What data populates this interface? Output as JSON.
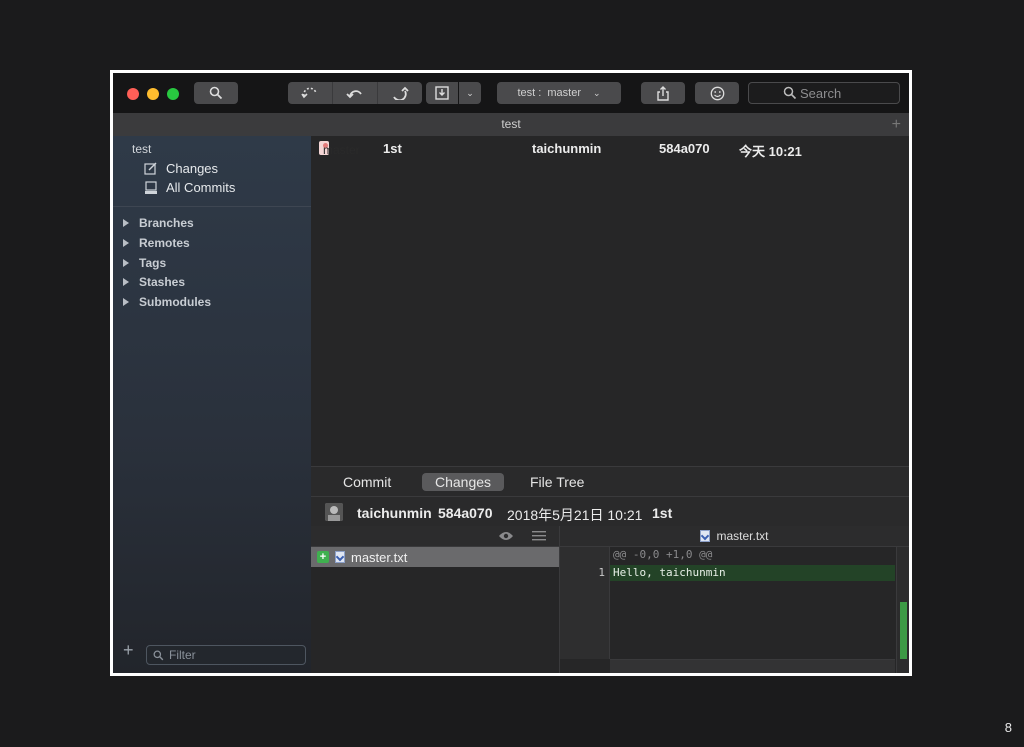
{
  "slide_number": "8",
  "toolbar": {
    "branch_selector": "test :  master",
    "search_placeholder": "Search"
  },
  "window": {
    "title": "test"
  },
  "sidebar": {
    "repo_name": "test",
    "items": [
      {
        "label": "Changes"
      },
      {
        "label": "All Commits"
      }
    ],
    "groups": [
      {
        "label": "Branches"
      },
      {
        "label": "Remotes"
      },
      {
        "label": "Tags"
      },
      {
        "label": "Stashes"
      },
      {
        "label": "Submodules"
      }
    ],
    "filter_placeholder": "Filter"
  },
  "commit_list": [
    {
      "branch": "master",
      "message": "1st",
      "author": "taichunmin",
      "hash": "584a070",
      "date": "今天 10:21"
    }
  ],
  "tabs": [
    {
      "label": "Commit",
      "active": false
    },
    {
      "label": "Changes",
      "active": true
    },
    {
      "label": "File Tree",
      "active": false
    }
  ],
  "commit_info": {
    "author": "taichunmin",
    "hash": "584a070",
    "date": "2018年5月21日 10:21",
    "message": "1st"
  },
  "files": [
    {
      "name": "master.txt",
      "status": "added"
    }
  ],
  "diff": {
    "file": "master.txt",
    "hunk": "@@ -0,0 +1,0 @@",
    "lines": [
      {
        "number": "1",
        "text": "Hello, taichunmin"
      }
    ]
  },
  "colors": {
    "close": "#fe5f57",
    "minimize": "#febc2e",
    "zoom": "#28c840",
    "branch_tag": "#f5d6d6",
    "diff_added": "#234327"
  }
}
